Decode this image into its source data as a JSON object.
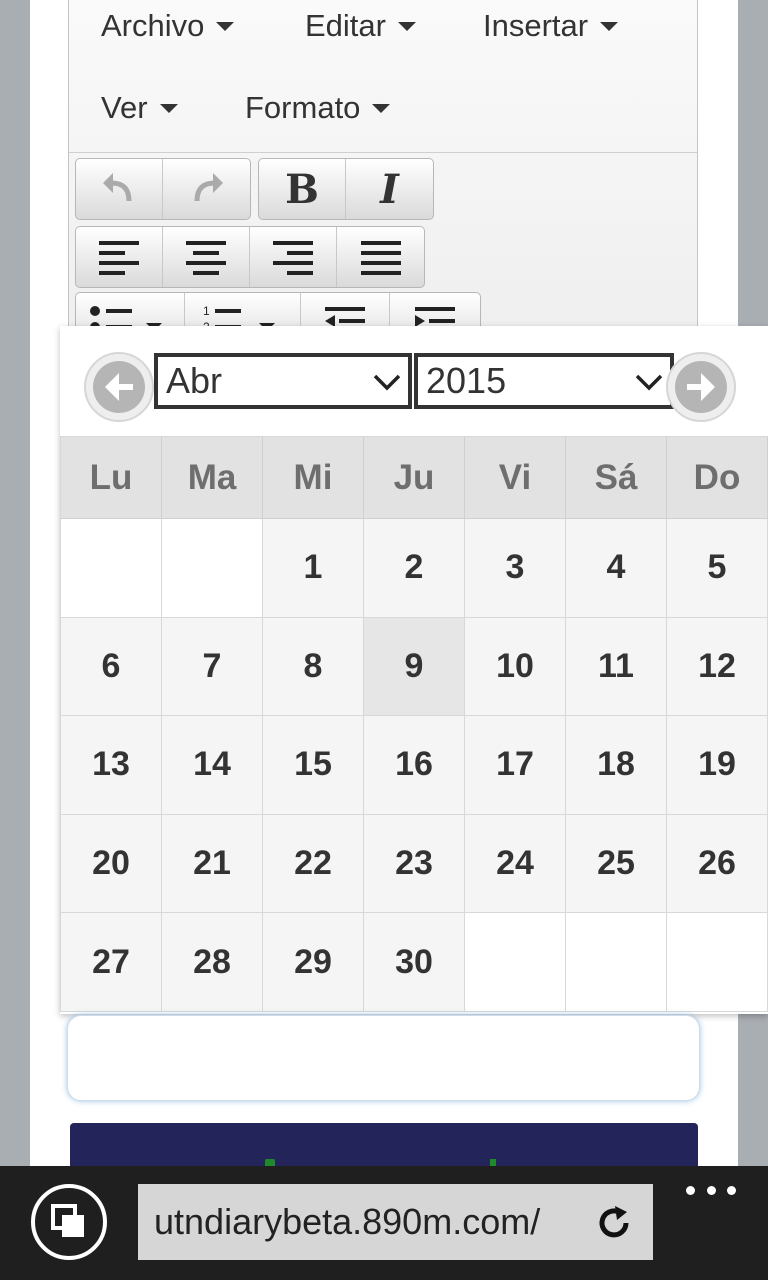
{
  "editor": {
    "menus": [
      "Archivo",
      "Editar",
      "Insertar",
      "Ver",
      "Formato"
    ],
    "toolbar": {
      "undo_icon": "undo-icon",
      "redo_icon": "redo-icon",
      "bold_label": "B",
      "italic_label": "I",
      "align_icons": [
        "align-left-icon",
        "align-center-icon",
        "align-right-icon",
        "align-justify-icon"
      ],
      "list_icons": [
        "bullet-list-icon",
        "numbered-list-icon",
        "outdent-icon",
        "indent-icon"
      ]
    }
  },
  "datepicker": {
    "month_selected": "Abr",
    "year_selected": "2015",
    "weekdays": [
      "Lu",
      "Ma",
      "Mi",
      "Ju",
      "Vi",
      "Sá",
      "Do"
    ],
    "days": [
      "",
      "",
      "1",
      "2",
      "3",
      "4",
      "5",
      "6",
      "7",
      "8",
      "9",
      "10",
      "11",
      "12",
      "13",
      "14",
      "15",
      "16",
      "17",
      "18",
      "19",
      "20",
      "21",
      "22",
      "23",
      "24",
      "25",
      "26",
      "27",
      "28",
      "29",
      "30",
      "",
      "",
      ""
    ],
    "highlighted_day": "9",
    "prev_icon": "arrow-left-icon",
    "next_icon": "arrow-right-icon"
  },
  "browser": {
    "url": "utndiarybeta.890m.com/",
    "tabs_icon": "tabs-icon",
    "reload_icon": "reload-icon",
    "more_icon": "more-icon"
  },
  "colors": {
    "panel_dark": "#23245a",
    "highlight": "#e6e6e6"
  }
}
